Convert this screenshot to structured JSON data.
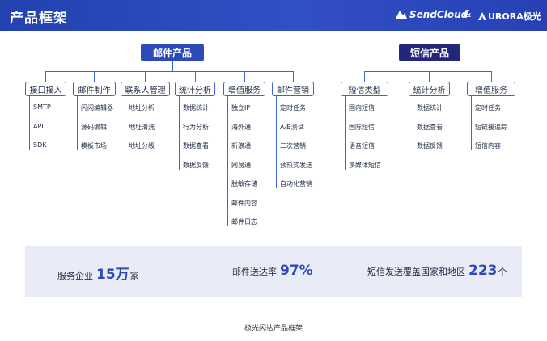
{
  "header": {
    "title": "产品框架",
    "brand_sendcloud": "SendCloud",
    "brand_amp": "&",
    "brand_aurora": "URORA极光"
  },
  "mail": {
    "root": "邮件产品",
    "categories": [
      {
        "label": "接口接入",
        "items": [
          "SMTP",
          "API",
          "SDK"
        ]
      },
      {
        "label": "邮件制作",
        "items": [
          "闪闪编辑器",
          "源码编辑",
          "模板市场"
        ]
      },
      {
        "label": "联系人管理",
        "items": [
          "地址分析",
          "地址清洗",
          "地址分级"
        ]
      },
      {
        "label": "统计分析",
        "items": [
          "数据统计",
          "行为分析",
          "数据查看",
          "数据反馈"
        ]
      },
      {
        "label": "增值服务",
        "items": [
          "独立IP",
          "海外通",
          "新浪通",
          "网易通",
          "脱敏存储",
          "邮件内容",
          "邮件日志"
        ]
      },
      {
        "label": "邮件营销",
        "items": [
          "定时任务",
          "A/B测试",
          "二次营销",
          "预热式发送",
          "自动化营销"
        ]
      }
    ]
  },
  "sms": {
    "root": "短信产品",
    "categories": [
      {
        "label": "短信类型",
        "items": [
          "国内短信",
          "国际短信",
          "语音短信",
          "多媒体短信"
        ]
      },
      {
        "label": "统计分析",
        "items": [
          "数据统计",
          "数据查看",
          "数据反馈"
        ]
      },
      {
        "label": "增值服务",
        "items": [
          "定时任务",
          "短链接追踪",
          "短信内容"
        ]
      }
    ]
  },
  "stats": [
    {
      "label": "服务企业",
      "value": "15万",
      "unit": "家"
    },
    {
      "label": "邮件送达率",
      "value": "97%",
      "unit": ""
    },
    {
      "label": "短信发送覆盖国家和地区",
      "value": "223",
      "unit": "个"
    }
  ],
  "caption": "极光闪达产品框架",
  "colors": {
    "accent": "#2c4bb9",
    "dark_root": "#22277a",
    "line": "#3f63d6",
    "stat_bg": "#e9ecf6"
  }
}
